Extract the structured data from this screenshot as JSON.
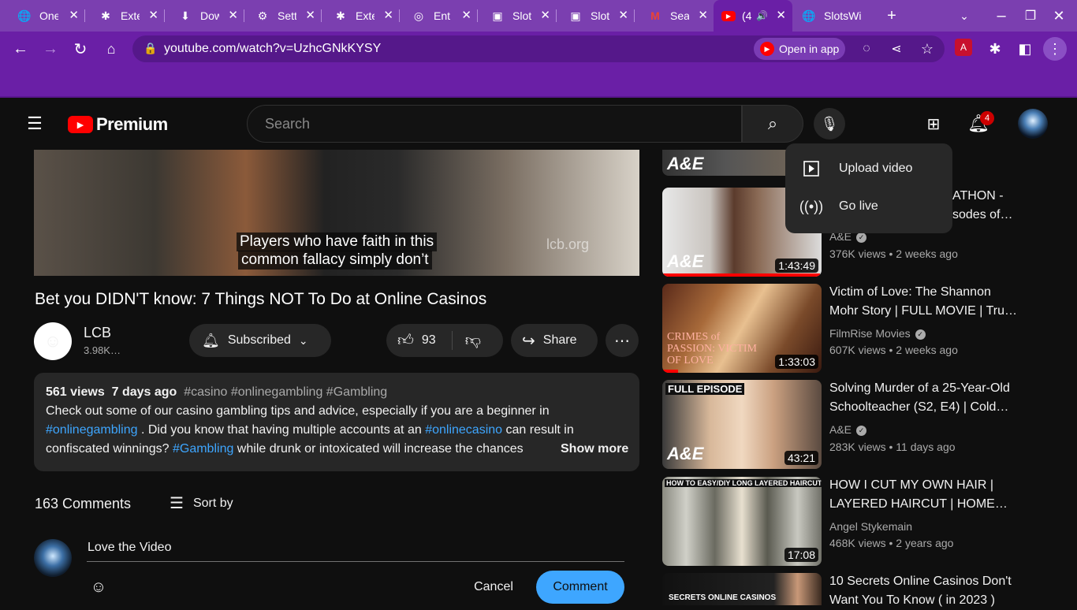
{
  "browser": {
    "tabs": [
      {
        "label": "One",
        "icon": "globe-icon"
      },
      {
        "label": "Exte",
        "icon": "puzzle-icon"
      },
      {
        "label": "Dow",
        "icon": "download-icon"
      },
      {
        "label": "Sett",
        "icon": "gear-icon"
      },
      {
        "label": "Exte",
        "icon": "puzzle-icon"
      },
      {
        "label": "Ent",
        "icon": "chrome-icon"
      },
      {
        "label": "Slot",
        "icon": "slot-game-icon"
      },
      {
        "label": "Slot",
        "icon": "slot-game-icon"
      },
      {
        "label": "Sea",
        "icon": "gmail-icon"
      },
      {
        "label": "(4",
        "icon": "youtube-icon",
        "active": true
      },
      {
        "label": "SlotsWi",
        "icon": "globe-icon"
      }
    ],
    "url": "youtube.com/watch?v=UzhcGNkKYSY",
    "open_in_app": "Open in app"
  },
  "youtube": {
    "logo_text": "Premium",
    "search_placeholder": "Search",
    "notification_count": "4",
    "create_menu": {
      "items": [
        {
          "label": "Upload video",
          "icon": "upload-video-icon"
        },
        {
          "label": "Go live",
          "icon": "go-live-icon"
        }
      ]
    }
  },
  "video": {
    "caption_line1": "Players who have faith in this",
    "caption_line2": "common fallacy simply don’t",
    "watermark": "lcb.org",
    "title": "Bet you DIDN'T know: 7 Things NOT To Do at Online Casinos",
    "channel": "LCB",
    "subscribers": "3.98K…",
    "subscribed_label": "Subscribed",
    "likes": "93",
    "share_label": "Share"
  },
  "description": {
    "views": "561 views",
    "age": "7 days ago",
    "tags": "#casino #onlinegambling #Gambling",
    "line1": "Check out some of our casino gambling tips and advice, especially if you are a beginner in",
    "line2_link1": "#onlinegambling",
    "line2_text": " . Did you know that having multiple accounts at an ",
    "line2_link2": "#onlinecasino",
    "line2_text2": " can result in",
    "line3_text": "confiscated winnings? ",
    "line3_link": "#Gambling",
    "line3_text2": " while drunk or intoxicated will increase the chances",
    "show_more": "Show more"
  },
  "comments": {
    "count": "163 Comments",
    "sort_label": "Sort by",
    "draft": "Love the Video",
    "cancel_label": "Cancel",
    "comment_label": "Comment"
  },
  "related": [
    {
      "title_line1": "",
      "title_line2": "",
      "channel": "",
      "meta": "",
      "duration": "",
      "thumb_text": "A&E"
    },
    {
      "title_line1": "ATHON -",
      "title_line2": "sodes of…",
      "channel": "A&E",
      "meta": "376K views  • 2 weeks ago",
      "duration": "1:43:49",
      "thumb_text": "A&E",
      "progress": 0.99
    },
    {
      "title_line1": "Victim of Love: The Shannon",
      "title_line2": "Mohr Story | FULL MOVIE | Tru…",
      "channel": "FilmRise Movies",
      "meta": "607K views  • 2 weeks ago",
      "duration": "1:33:03",
      "thumb_text": "CRIMES of PASSION: VICTIM OF LOVE",
      "progress": 0.1
    },
    {
      "title_line1": "Solving Murder of a 25-Year-Old",
      "title_line2": "Schoolteacher (S2, E4) | Cold…",
      "channel": "A&E",
      "meta": "283K views  • 11 days ago",
      "duration": "43:21",
      "thumb_text": "FULL EPISODE"
    },
    {
      "title_line1": "HOW I CUT MY OWN HAIR |",
      "title_line2": "LAYERED HAIRCUT | HOME…",
      "channel": "Angel Stykemain",
      "meta": "468K views  • 2 years ago",
      "duration": "17:08",
      "thumb_text": "HOW TO EASY/DIY LONG LAYERED HAIRCUT"
    },
    {
      "title_line1": "10 Secrets Online Casinos Don't",
      "title_line2": "Want You To Know ( in 2023 )",
      "channel": "",
      "meta": "",
      "duration": "",
      "thumb_text": "SECRETS ONLINE CASINOS"
    }
  ],
  "colors": {
    "browser_accent": "#6a1fa6",
    "youtube_red": "#ff0000",
    "link": "#3ea6ff"
  }
}
